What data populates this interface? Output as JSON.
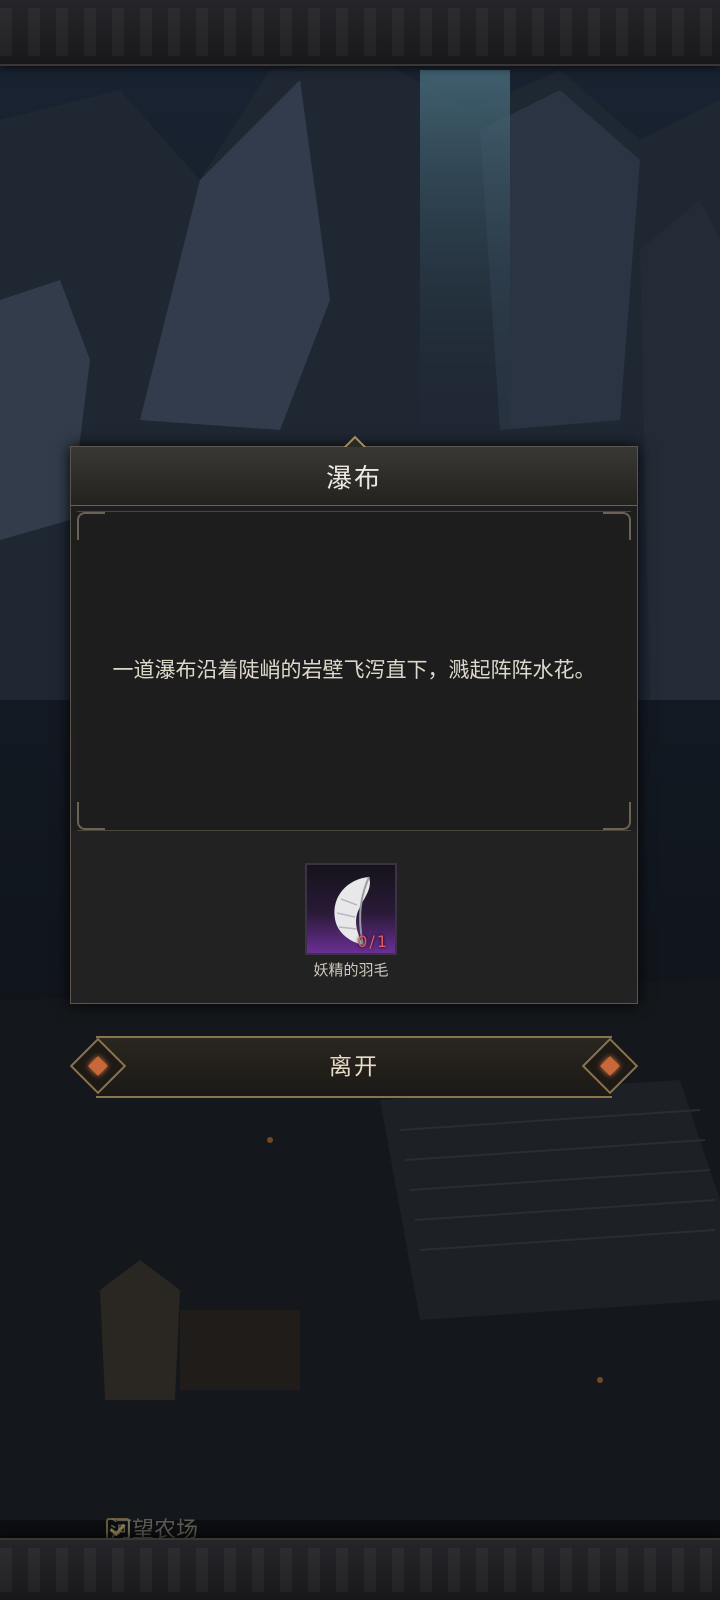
{
  "dialog": {
    "title": "瀑布",
    "description": "一道瀑布沿着陡峭的岩壁飞泻直下，溅起阵阵水花。",
    "reward": {
      "item_name": "妖精的羽毛",
      "count": "0/1",
      "icon": "feather-icon"
    }
  },
  "leave_button": {
    "label": "离开"
  },
  "location": {
    "label": "河望农场"
  },
  "colors": {
    "item_rarity": "#6a2f94",
    "count_text": "#e25b63",
    "accent": "#c8673a"
  }
}
